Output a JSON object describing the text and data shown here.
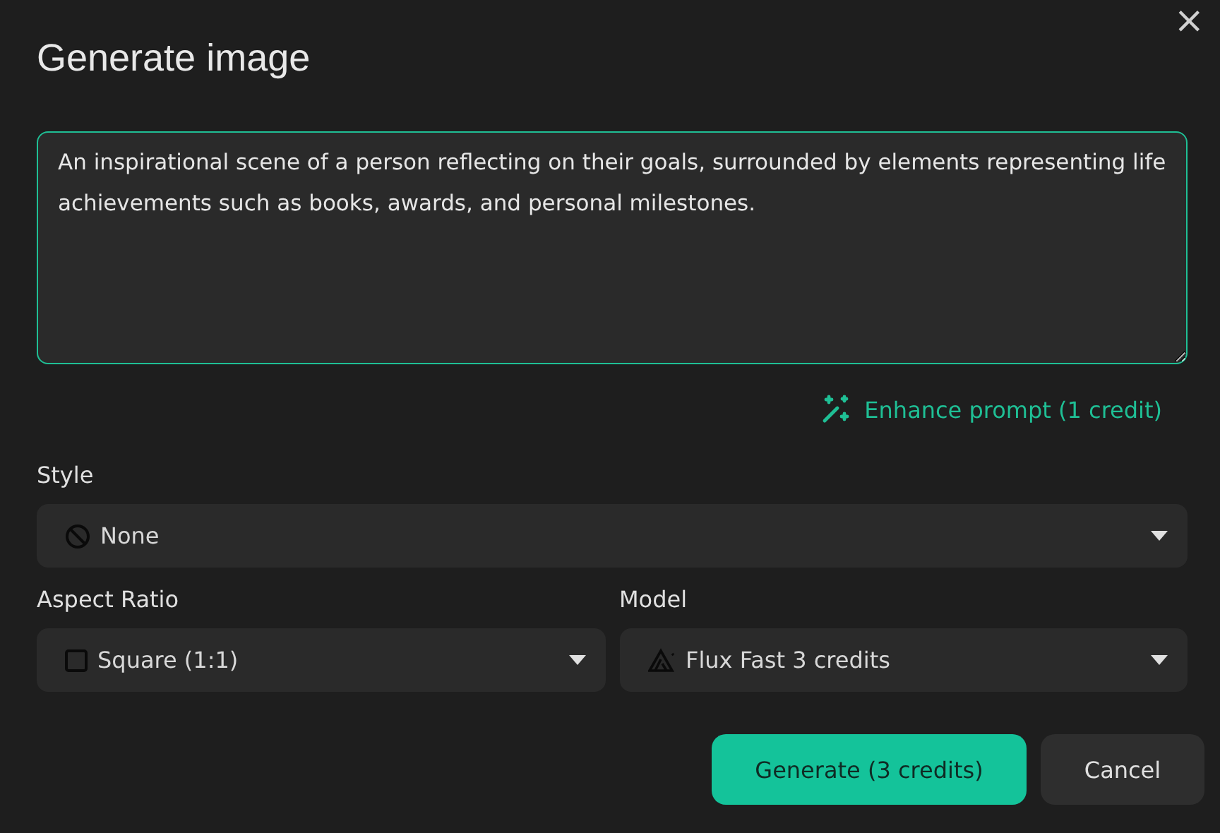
{
  "dialog": {
    "title": "Generate image",
    "close": "×"
  },
  "prompt": {
    "value": "An inspirational scene of a person reflecting on their goals, surrounded by elements representing life achievements such as books, awards, and personal milestones."
  },
  "enhance": {
    "label": "Enhance prompt (1 credit)"
  },
  "style": {
    "label": "Style",
    "value": "None"
  },
  "aspect_ratio": {
    "label": "Aspect Ratio",
    "value": "Square (1:1)"
  },
  "model": {
    "label": "Model",
    "value": "Flux Fast 3 credits"
  },
  "buttons": [
    {
      "label": "Generate (3 credits)",
      "kind": "primary"
    },
    {
      "label": "Cancel",
      "kind": "secondary"
    }
  ]
}
